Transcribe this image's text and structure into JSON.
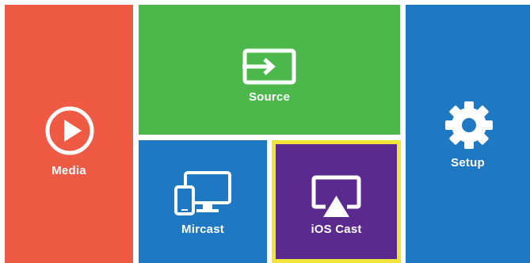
{
  "tiles": {
    "media": {
      "label": "Media",
      "color": "#ee5a43",
      "icon": "play-circle-icon"
    },
    "source": {
      "label": "Source",
      "color": "#4cb84c",
      "icon": "input-source-icon"
    },
    "mircast": {
      "label": "Mircast",
      "color": "#1e78c2",
      "icon": "devices-icon"
    },
    "ios_cast": {
      "label": "iOS Cast",
      "color": "#5b2a8e",
      "icon": "airplay-icon",
      "selected": true,
      "focus_color": "#f0e33a"
    },
    "setup": {
      "label": "Setup",
      "color": "#1e78c2",
      "icon": "gear-icon"
    }
  }
}
